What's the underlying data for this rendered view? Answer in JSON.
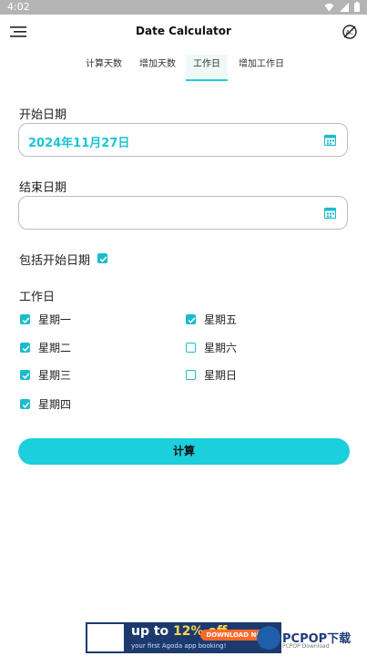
{
  "status": {
    "time": "4:02"
  },
  "appbar": {
    "title": "Date Calculator"
  },
  "tabs": [
    {
      "label": "计算天数"
    },
    {
      "label": "增加天数"
    },
    {
      "label": "工作日"
    },
    {
      "label": "增加工作日"
    }
  ],
  "active_tab": "工作日",
  "start": {
    "label": "开始日期",
    "value": "2024年11月27日"
  },
  "end": {
    "label": "结束日期",
    "value": ""
  },
  "include_start": {
    "label": "包括开始日期",
    "checked": true
  },
  "workdays": {
    "label": "工作日",
    "days": [
      {
        "label": "星期一",
        "checked": true
      },
      {
        "label": "星期二",
        "checked": true
      },
      {
        "label": "星期三",
        "checked": true
      },
      {
        "label": "星期四",
        "checked": true
      },
      {
        "label": "星期五",
        "checked": true
      },
      {
        "label": "星期六",
        "checked": false
      },
      {
        "label": "星期日",
        "checked": false
      }
    ]
  },
  "calculate_label": "计算",
  "ad": {
    "headline_pre": "up to ",
    "headline_pct": "12% off",
    "sub": "your first Agoda app booking!",
    "download": "DOWNLOAD NOW"
  },
  "watermark": {
    "text": "PCPOP下载",
    "sub": "PCPOP Download"
  },
  "colors": {
    "accent": "#1bcfdc",
    "status_bar": "#b4b4b4"
  },
  "icons": [
    "menu-icon",
    "clear-icon",
    "calendar-icon",
    "check-icon",
    "wifi-icon",
    "signal-icon",
    "battery-icon"
  ]
}
